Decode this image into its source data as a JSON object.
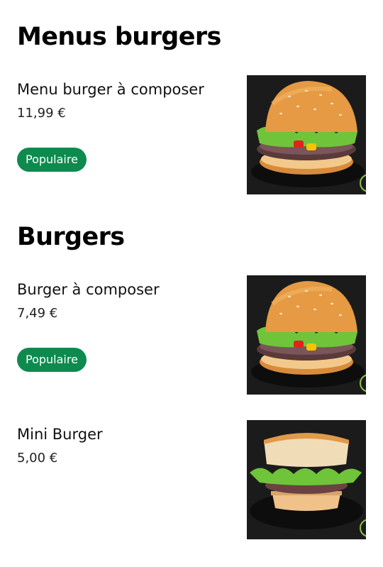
{
  "sections": [
    {
      "title": "Menus burgers",
      "items": [
        {
          "name": "Menu burger à composer",
          "price": "11,99 €",
          "badge": "Populaire",
          "image": "burger-full-icon"
        }
      ]
    },
    {
      "title": "Burgers",
      "items": [
        {
          "name": "Burger à composer",
          "price": "7,49 €",
          "badge": "Populaire",
          "image": "burger-full-icon"
        },
        {
          "name": "Mini Burger",
          "price": "5,00 €",
          "image": "mini-burger-icon"
        }
      ]
    }
  ],
  "colors": {
    "badge_background": "#0e8a4f",
    "badge_text": "#ffffff",
    "image_background": "#1b1b1c"
  }
}
